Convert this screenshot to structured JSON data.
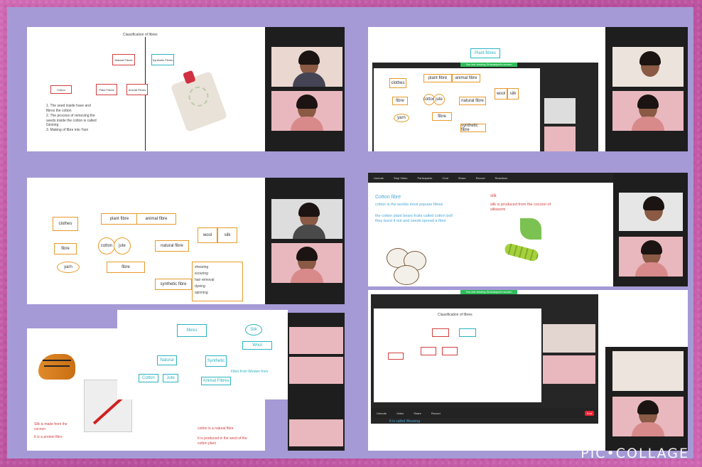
{
  "watermark": "PIC•COLLAGE",
  "panel1": {
    "title": "Classification of fibres",
    "nodes": [
      "Natural Fibres",
      "Synthetic Fibres",
      "Plant Fibres",
      "Animal Fibres",
      "Cotton"
    ],
    "notes": [
      "1. The seed inside have and fibres the cotton",
      "2. The process of removing the seeds inside the cotton is called Ginning",
      "3. Making of fibre into Yarn"
    ]
  },
  "panel2": {
    "top_label": "Plant fibres",
    "green": "You are viewing Sivaranjani's screen",
    "nodes": [
      "clothes",
      "plant fibre",
      "animal fibre",
      "fibre",
      "cotton",
      "jute",
      "natural fibre",
      "yarn",
      "fibre",
      "synthetic fibre",
      "wool",
      "silk"
    ]
  },
  "panel3": {
    "nodes": [
      "clothes",
      "plant fibre",
      "animal fibre",
      "fibre",
      "cotton",
      "jute",
      "natural fibre",
      "yarn",
      "fibre",
      "wool",
      "silk",
      "synthetic fibre"
    ],
    "list": [
      "shearing",
      "scouring",
      "hair removal",
      "dyeing",
      "spinning"
    ]
  },
  "panel4": {
    "heading": "Cotton fibre",
    "body": [
      "cotton is the worlds most popular fibres",
      "the cotton plant bears fruits called cotton boll they burst it out and seeds spread a fibre"
    ],
    "silk": "silk",
    "silk_note": "silk is produced from the cocoon of silkworm"
  },
  "panel5": {
    "nodes": [
      "fibres",
      "Natural",
      "Synthetic",
      "Cotton",
      "Jute",
      "Animal Fibres",
      "Silk",
      "Wool"
    ],
    "foot1": "Silk is made from the cocoon",
    "foot2": "It is a protein fibre",
    "foot3": "cotton is a natural fibre",
    "foot4": "It is produced in the seed of the cotton plant",
    "extra": "Fibre from Woolen from"
  },
  "panel6": {
    "top": "Classification of fibres",
    "green": "You are viewing Sivaranjani's screen",
    "note": "It is called Weaving"
  }
}
